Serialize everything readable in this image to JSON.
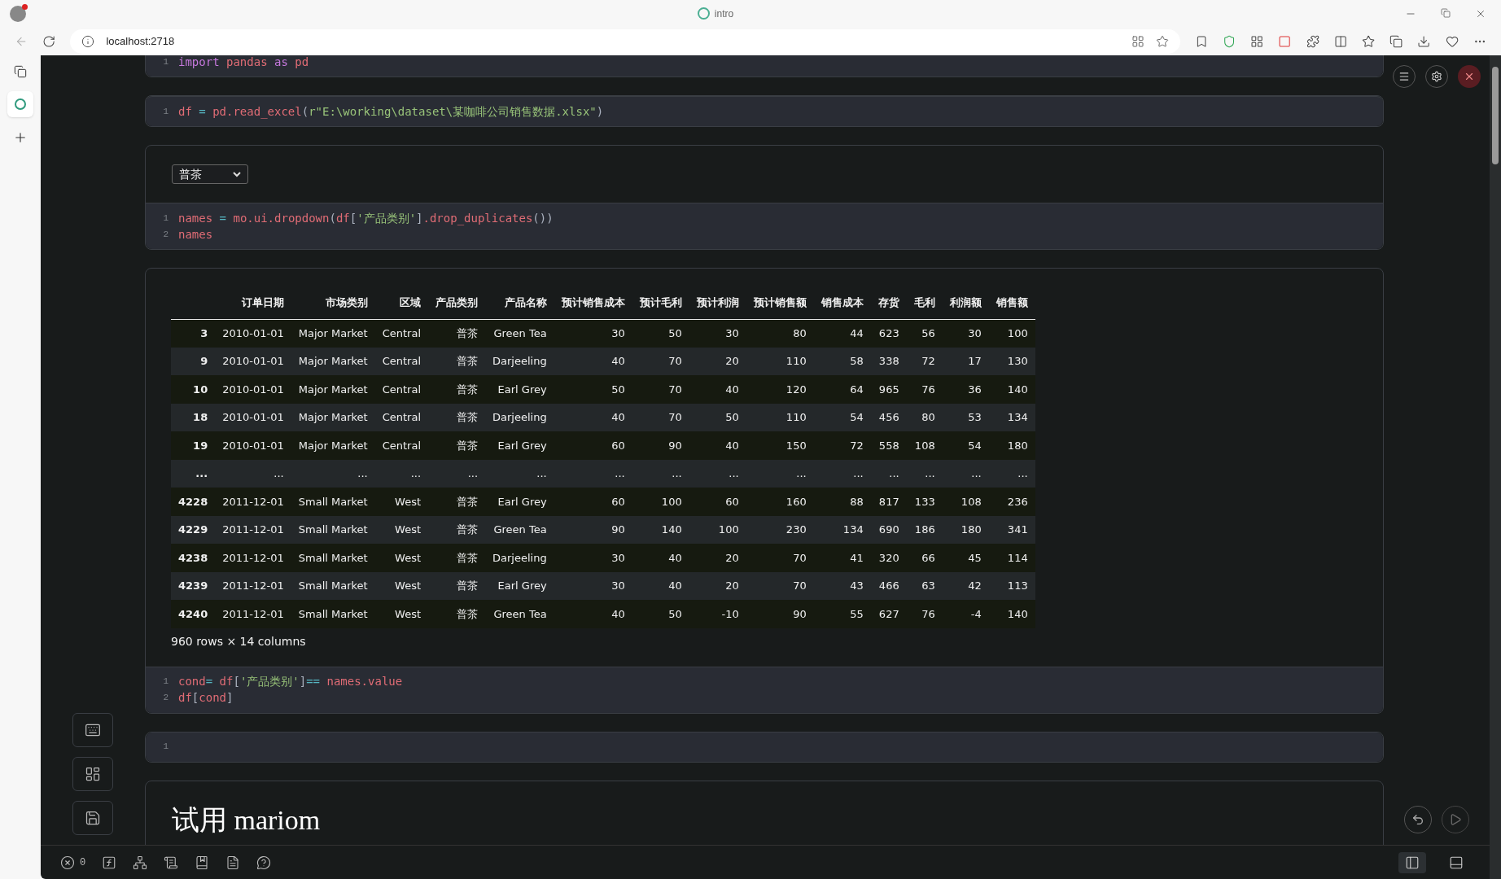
{
  "window": {
    "title": "intro"
  },
  "address_bar": {
    "url": "localhost:2718"
  },
  "cells": [
    {
      "kind": "code",
      "lines": [
        {
          "number": "1",
          "tokens": [
            {
              "text": "import ",
              "color": "#c678dd"
            },
            {
              "text": "pandas ",
              "color": "#e06c75"
            },
            {
              "text": "as ",
              "color": "#c678dd"
            },
            {
              "text": "pd",
              "color": "#e06c75"
            }
          ]
        }
      ]
    },
    {
      "kind": "code",
      "lines": [
        {
          "number": "1",
          "tokens": [
            {
              "text": "df",
              "color": "#e06c75"
            },
            {
              "text": " = ",
              "color": "#56b6c2"
            },
            {
              "text": "pd.read_excel",
              "color": "#e06c75"
            },
            {
              "text": "(",
              "color": "#abb2bf"
            },
            {
              "text": "r\"E:\\working\\dataset\\某咖啡公司销售数据.xlsx\"",
              "color": "#98c379"
            },
            {
              "text": ")",
              "color": "#abb2bf"
            }
          ]
        }
      ]
    },
    {
      "kind": "dropdown",
      "value": "普茶",
      "lines": [
        {
          "number": "1",
          "tokens": [
            {
              "text": "names",
              "color": "#e06c75"
            },
            {
              "text": " = ",
              "color": "#56b6c2"
            },
            {
              "text": "mo.ui.dropdown",
              "color": "#e06c75"
            },
            {
              "text": "(",
              "color": "#abb2bf"
            },
            {
              "text": "df",
              "color": "#e06c75"
            },
            {
              "text": "[",
              "color": "#abb2bf"
            },
            {
              "text": "'产品类别'",
              "color": "#98c379"
            },
            {
              "text": "]",
              "color": "#abb2bf"
            },
            {
              "text": ".drop_duplicates",
              "color": "#e06c75"
            },
            {
              "text": "())",
              "color": "#abb2bf"
            }
          ]
        },
        {
          "number": "2",
          "tokens": [
            {
              "text": "names",
              "color": "#e06c75"
            }
          ]
        }
      ]
    },
    {
      "kind": "table",
      "caption": "960 rows × 14 columns",
      "columns": [
        "",
        "订单日期",
        "市场类别",
        "区域",
        "产品类别",
        "产品名称",
        "预计销售成本",
        "预计毛利",
        "预计利润",
        "预计销售额",
        "销售成本",
        "存货",
        "毛利",
        "利润额",
        "销售额"
      ],
      "rows": [
        [
          "3",
          "2010-01-01",
          "Major Market",
          "Central",
          "普茶",
          "Green Tea",
          "30",
          "50",
          "30",
          "80",
          "44",
          "623",
          "56",
          "30",
          "100"
        ],
        [
          "9",
          "2010-01-01",
          "Major Market",
          "Central",
          "普茶",
          "Darjeeling",
          "40",
          "70",
          "20",
          "110",
          "58",
          "338",
          "72",
          "17",
          "130"
        ],
        [
          "10",
          "2010-01-01",
          "Major Market",
          "Central",
          "普茶",
          "Earl Grey",
          "50",
          "70",
          "40",
          "120",
          "64",
          "965",
          "76",
          "36",
          "140"
        ],
        [
          "18",
          "2010-01-01",
          "Major Market",
          "Central",
          "普茶",
          "Darjeeling",
          "40",
          "70",
          "50",
          "110",
          "54",
          "456",
          "80",
          "53",
          "134"
        ],
        [
          "19",
          "2010-01-01",
          "Major Market",
          "Central",
          "普茶",
          "Earl Grey",
          "60",
          "90",
          "40",
          "150",
          "72",
          "558",
          "108",
          "54",
          "180"
        ],
        [
          "...",
          "...",
          "...",
          "...",
          "...",
          "...",
          "...",
          "...",
          "...",
          "...",
          "...",
          "...",
          "...",
          "...",
          "..."
        ],
        [
          "4228",
          "2011-12-01",
          "Small Market",
          "West",
          "普茶",
          "Earl Grey",
          "60",
          "100",
          "60",
          "160",
          "88",
          "817",
          "133",
          "108",
          "236"
        ],
        [
          "4229",
          "2011-12-01",
          "Small Market",
          "West",
          "普茶",
          "Green Tea",
          "90",
          "140",
          "100",
          "230",
          "134",
          "690",
          "186",
          "180",
          "341"
        ],
        [
          "4238",
          "2011-12-01",
          "Small Market",
          "West",
          "普茶",
          "Darjeeling",
          "30",
          "40",
          "20",
          "70",
          "41",
          "320",
          "66",
          "45",
          "114"
        ],
        [
          "4239",
          "2011-12-01",
          "Small Market",
          "West",
          "普茶",
          "Earl Grey",
          "30",
          "40",
          "20",
          "70",
          "43",
          "466",
          "63",
          "42",
          "113"
        ],
        [
          "4240",
          "2011-12-01",
          "Small Market",
          "West",
          "普茶",
          "Green Tea",
          "40",
          "50",
          "-10",
          "90",
          "55",
          "627",
          "76",
          "-4",
          "140"
        ]
      ],
      "lines": [
        {
          "number": "1",
          "tokens": [
            {
              "text": "cond",
              "color": "#e06c75"
            },
            {
              "text": "= ",
              "color": "#56b6c2"
            },
            {
              "text": "df",
              "color": "#e06c75"
            },
            {
              "text": "[",
              "color": "#abb2bf"
            },
            {
              "text": "'产品类别'",
              "color": "#98c379"
            },
            {
              "text": "]",
              "color": "#abb2bf"
            },
            {
              "text": "== ",
              "color": "#56b6c2"
            },
            {
              "text": "names.value",
              "color": "#e06c75"
            }
          ]
        },
        {
          "number": "2",
          "tokens": [
            {
              "text": "df",
              "color": "#e06c75"
            },
            {
              "text": "[",
              "color": "#abb2bf"
            },
            {
              "text": "cond",
              "color": "#e06c75"
            },
            {
              "text": "]",
              "color": "#abb2bf"
            }
          ]
        }
      ]
    },
    {
      "kind": "empty",
      "lines": [
        {
          "number": "1"
        }
      ]
    },
    {
      "kind": "markdown",
      "heading": "试用 mariom"
    }
  ],
  "status_bar": {
    "error_count": "0",
    "layout_buttons": [
      {
        "selected": true
      },
      {
        "selected": false
      }
    ]
  }
}
